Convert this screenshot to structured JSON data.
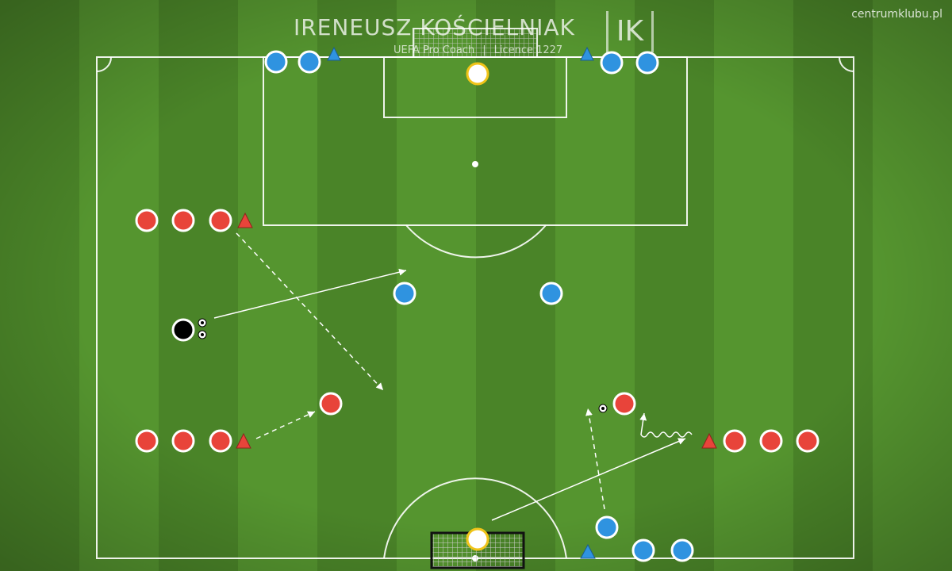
{
  "branding": {
    "coach_name": "IRENEUSZ KOŚCIELNIAK",
    "role": "UEFA Pro Coach",
    "licence": "Licence 1227",
    "logo_text": "IK",
    "site": "centrumklubu.pl"
  },
  "colors": {
    "grass_dark": "#4a8428",
    "grass_light": "#5a9a32",
    "line": "#ffffff",
    "blue_player": "#2f93e0",
    "red_player": "#e8443a",
    "keeper": "#ffffff",
    "keeper_ring": "#f0c419",
    "coach": "#000000",
    "cone_blue": "#2f93e0",
    "cone_red": "#e8443a"
  },
  "legend_icons": {
    "player": "player-marker",
    "cone": "cone-icon",
    "ball": "ball-icon"
  }
}
